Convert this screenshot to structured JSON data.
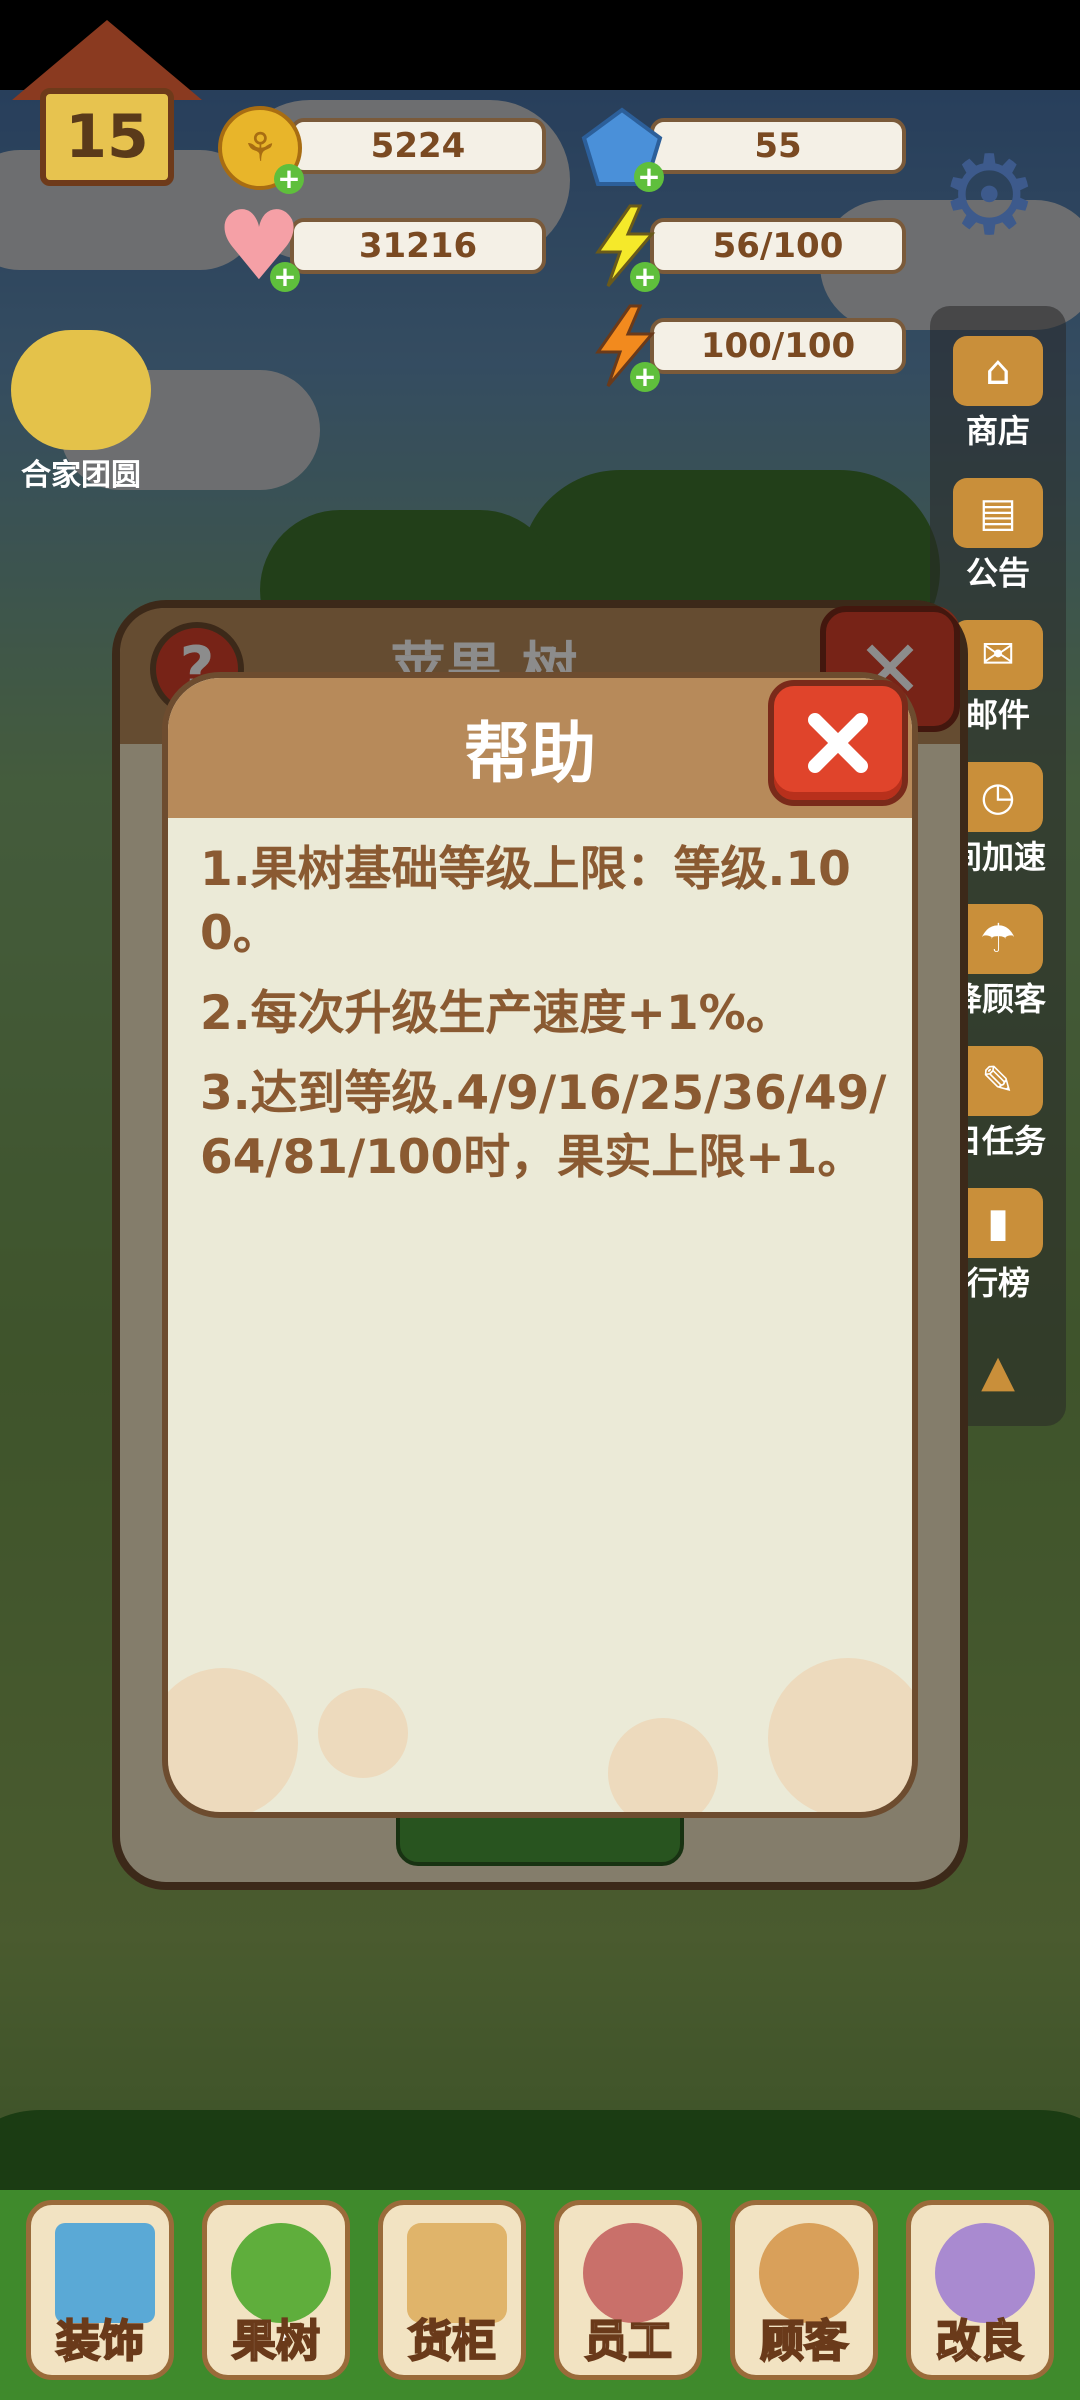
{
  "hud": {
    "level": "15",
    "coins": "5224",
    "gems": "55",
    "hearts": "31216",
    "energy_yellow": "56/100",
    "energy_orange": "100/100"
  },
  "side_left": {
    "family_label": "合家团圆"
  },
  "side_right": {
    "items": [
      {
        "label": "商店"
      },
      {
        "label": "公告"
      },
      {
        "label": "邮件"
      },
      {
        "label": "间加速"
      },
      {
        "label": "降顾客"
      },
      {
        "label": "日任务"
      },
      {
        "label": "行榜"
      }
    ]
  },
  "bottom_nav": {
    "items": [
      {
        "label": "装饰"
      },
      {
        "label": "果树"
      },
      {
        "label": "货柜"
      },
      {
        "label": "员工"
      },
      {
        "label": "顾客"
      },
      {
        "label": "改良"
      }
    ]
  },
  "tree_panel": {
    "title": "苹果 树",
    "help_glyph": "?"
  },
  "help_dialog": {
    "title": "帮助",
    "items": [
      {
        "text": "1.果树基础等级上限：等级.100。"
      },
      {
        "text": "2.每次升级生产速度+1%。"
      },
      {
        "text": "3.达到等级.4/9/16/25/36/49/64/81/100时，果实上限+1。"
      }
    ]
  },
  "colors": {
    "header_brown": "#b78a5a",
    "dialog_bg": "#ebead7",
    "text_brown": "#8a5a32",
    "close_red": "#e0442b"
  }
}
